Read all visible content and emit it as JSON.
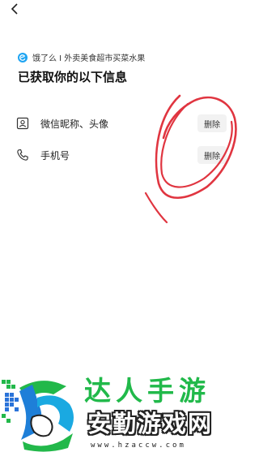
{
  "header": {
    "back_icon": "chevron-left-icon"
  },
  "app": {
    "name": "饿了么 I 外卖美食超市买菜水果",
    "logo_icon": "eleme-logo-icon",
    "logo_color": "#1ea4f2"
  },
  "title": "已获取你的以下信息",
  "permissions": [
    {
      "icon": "id-card-icon",
      "label": "微信昵称、头像",
      "action": "删除"
    },
    {
      "icon": "phone-icon",
      "label": "手机号",
      "action": "删除"
    }
  ],
  "annotation": {
    "color": "#e03540"
  },
  "watermark": {
    "top_text": "达人手游",
    "brand": "安勤游戏网",
    "url": "www.hzaccw.com",
    "top_color": "#21b94a"
  }
}
